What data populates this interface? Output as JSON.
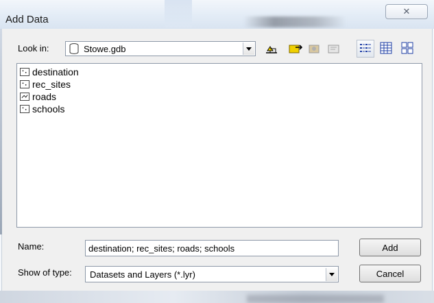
{
  "window": {
    "title": "Add Data",
    "close_glyph": "✕"
  },
  "lookin": {
    "label": "Look in:",
    "value": "Stowe.gdb"
  },
  "toolbar": {
    "icons": [
      "up-one-level-icon",
      "connect-folder-icon",
      "disconnect-folder-icon",
      "new-folder-icon",
      "list-view-icon",
      "details-view-icon",
      "thumbnails-view-icon"
    ]
  },
  "files": [
    {
      "name": "destination",
      "icon": "point-feature-class-icon"
    },
    {
      "name": "rec_sites",
      "icon": "point-feature-class-icon"
    },
    {
      "name": "roads",
      "icon": "line-feature-class-icon"
    },
    {
      "name": "schools",
      "icon": "point-feature-class-icon"
    }
  ],
  "name_field": {
    "label": "Name:",
    "value": "destination; rec_sites; roads; schools"
  },
  "type_field": {
    "label": "Show of type:",
    "value": "Datasets and Layers (*.lyr)"
  },
  "buttons": {
    "add": "Add",
    "cancel": "Cancel"
  },
  "colors": {
    "accent_yellow": "#f0d000",
    "toolbar_blue": "#1f3fa6",
    "title_bg": "#dfe8f3"
  }
}
